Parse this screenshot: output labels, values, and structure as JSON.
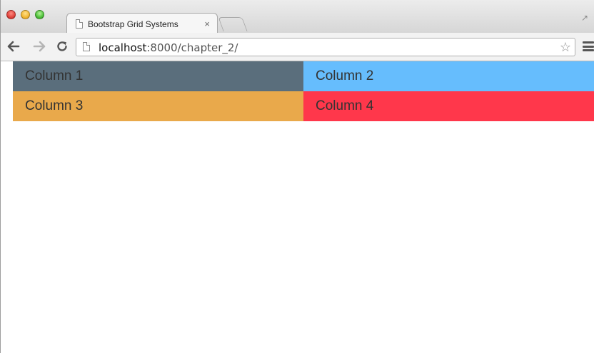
{
  "browser": {
    "tab": {
      "title": "Bootstrap Grid Systems",
      "close": "×"
    },
    "address": {
      "host": "localhost",
      "rest": ":8000/chapter_2/"
    },
    "icons": {
      "back": "back-arrow-icon",
      "forward": "forward-arrow-icon",
      "reload": "reload-icon",
      "star": "☆",
      "fullscreen": "↗",
      "menu": "hamburger-menu-icon"
    }
  },
  "grid": {
    "rows": [
      [
        {
          "label": "Column 1",
          "color": "#5a6e7c"
        },
        {
          "label": "Column 2",
          "color": "#66bdfd"
        }
      ],
      [
        {
          "label": "Column 3",
          "color": "#e9a94b"
        },
        {
          "label": "Column 4",
          "color": "#ff374b"
        }
      ]
    ]
  }
}
